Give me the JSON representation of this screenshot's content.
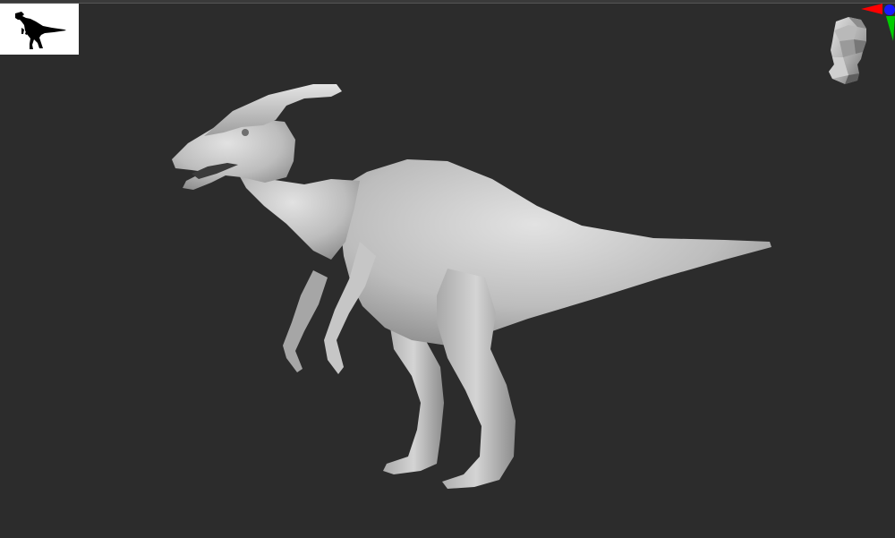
{
  "viewport": {
    "background_color": "#2c2c2c",
    "model_color": "#c9c9c9"
  },
  "thumbnail": {
    "icon": "dinosaur-silhouette-icon",
    "background_color": "#ffffff",
    "silhouette_color": "#000000"
  },
  "navigation_head": {
    "icon": "navigation-head-icon"
  },
  "axis_gizmo": {
    "icon": "axis-gizmo-icon",
    "colors": {
      "x": "#ff0000",
      "y": "#00cc00",
      "z": "#0000ff"
    }
  },
  "model": {
    "icon": "parasaurolophus-model"
  }
}
